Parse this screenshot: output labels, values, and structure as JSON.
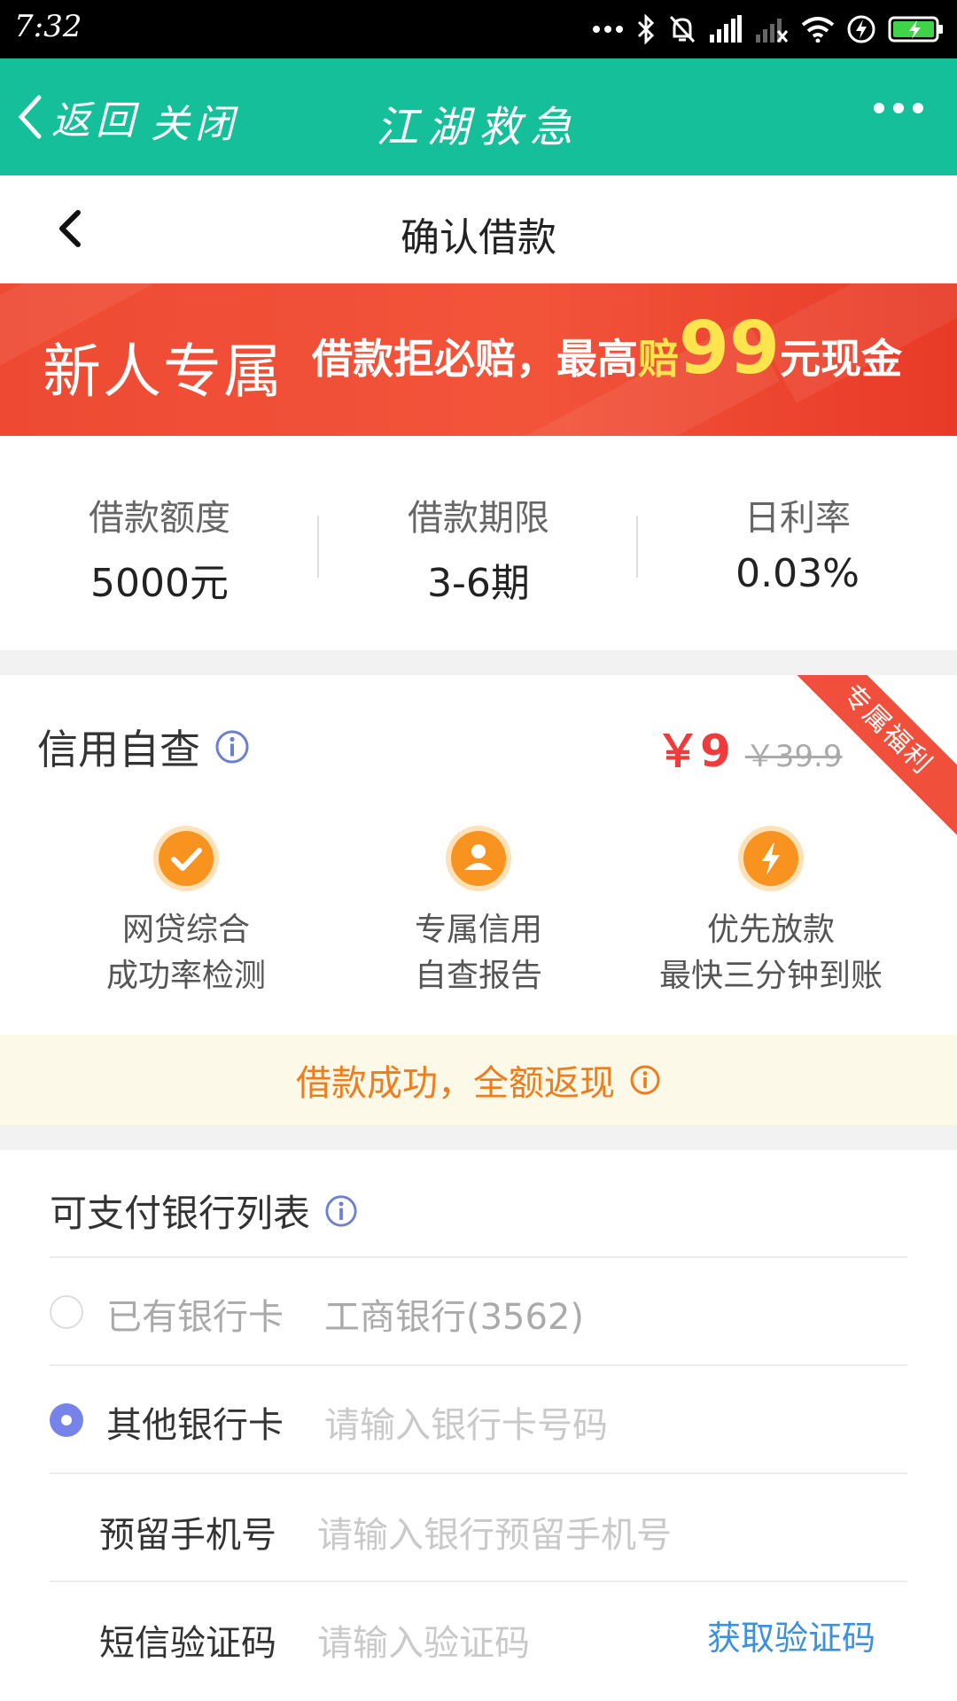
{
  "status_bar": {
    "time": "7:32",
    "icons": [
      "more-dots-icon",
      "bluetooth-icon",
      "mute-bell-icon",
      "signal-icon",
      "signal-weak-icon",
      "wifi-icon",
      "charging-icon",
      "battery-icon"
    ]
  },
  "app_bar": {
    "back_label": "返回",
    "close_label": "关闭",
    "title": "江湖救急"
  },
  "page": {
    "title": "确认借款"
  },
  "banner": {
    "left_text": "新人专属",
    "text_part1": "借款拒必赔，最高",
    "text_part2": "赔",
    "amount": "99",
    "text_part3": "元现金"
  },
  "loan_info": [
    {
      "label": "借款额度",
      "value": "5000元"
    },
    {
      "label": "借款期限",
      "value": "3-6期"
    },
    {
      "label": "日利率",
      "value": "0.03%"
    }
  ],
  "credit_check": {
    "title": "信用自查",
    "price_now": "￥9",
    "price_old": "￥39.9",
    "ribbon": "专属福利",
    "features": [
      {
        "line1": "网贷综合",
        "line2": "成功率检测",
        "icon": "check-icon"
      },
      {
        "line1": "专属信用",
        "line2": "自查报告",
        "icon": "user-icon"
      },
      {
        "line1": "优先放款",
        "line2": "最快三分钟到账",
        "icon": "lightning-icon"
      }
    ]
  },
  "cashback": {
    "text": "借款成功，全额返现"
  },
  "bank_list": {
    "title": "可支付银行列表",
    "existing_label": "已有银行卡",
    "existing_value": "工商银行(3562)",
    "other_label": "其他银行卡",
    "other_placeholder": "请输入银行卡号码",
    "phone_label": "预留手机号",
    "phone_placeholder": "请输入银行预留手机号",
    "sms_label": "短信验证码",
    "sms_placeholder": "请输入验证码",
    "sms_button": "获取验证码"
  },
  "colors": {
    "app_bar": "#14bf9a",
    "banner": "#ee4a33",
    "price_red": "#ef3b3b",
    "cashback_orange": "#f07c1c",
    "link_blue": "#3d8fe0",
    "radio_selected": "#7683e9",
    "info_icon": "#6b7fd6"
  }
}
